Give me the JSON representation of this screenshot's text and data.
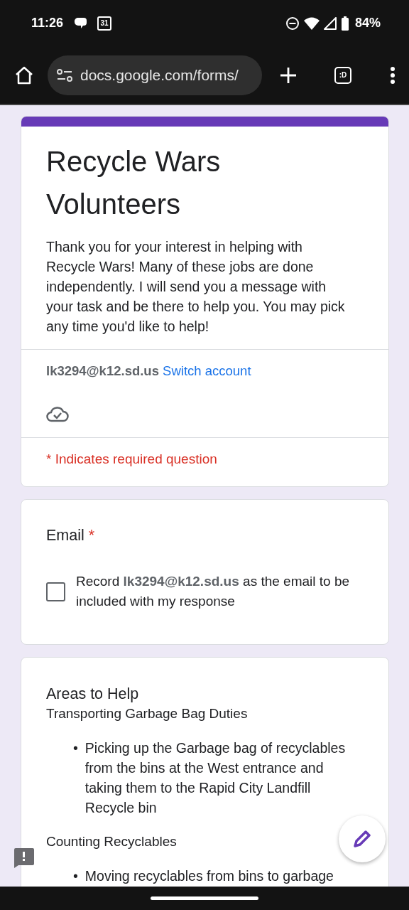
{
  "status_bar": {
    "time": "11:26",
    "calendar_day": "31",
    "battery": "84%"
  },
  "browser": {
    "url": "docs.google.com/forms/",
    "tab_switcher": ":D"
  },
  "form": {
    "title": "Recycle Wars Volunteers",
    "description": "Thank you for your interest in helping with Recycle Wars! Many of these jobs are done independently. I will send you a message with your task and be there to help you. You may pick any time you'd like to help!",
    "account": "lk3294@k12.sd.us",
    "switch_link": "Switch account",
    "required_note": "* Indicates required question"
  },
  "questions": [
    {
      "kind": "checkbox",
      "title": "Email",
      "required_mark": "*",
      "checkbox_label": "Record **lk3294@k12.sd.us** as the email to be included with my response",
      "checked": false
    },
    {
      "kind": "section",
      "title": "Areas to Help",
      "blocks": [
        {
          "heading": "Transporting Garbage Bag Duties",
          "bullets": [
            {
              "marker": "•",
              "text": "Picking up the Garbage bag of recyclables from the bins at the West entrance and taking them to the Rapid City Landfill Recycle bin"
            }
          ]
        },
        {
          "heading": "Counting Recyclables",
          "bullets": [
            {
              "marker": "•",
              "text": "Moving recyclables from bins to garbage"
            }
          ]
        }
      ]
    }
  ]
}
